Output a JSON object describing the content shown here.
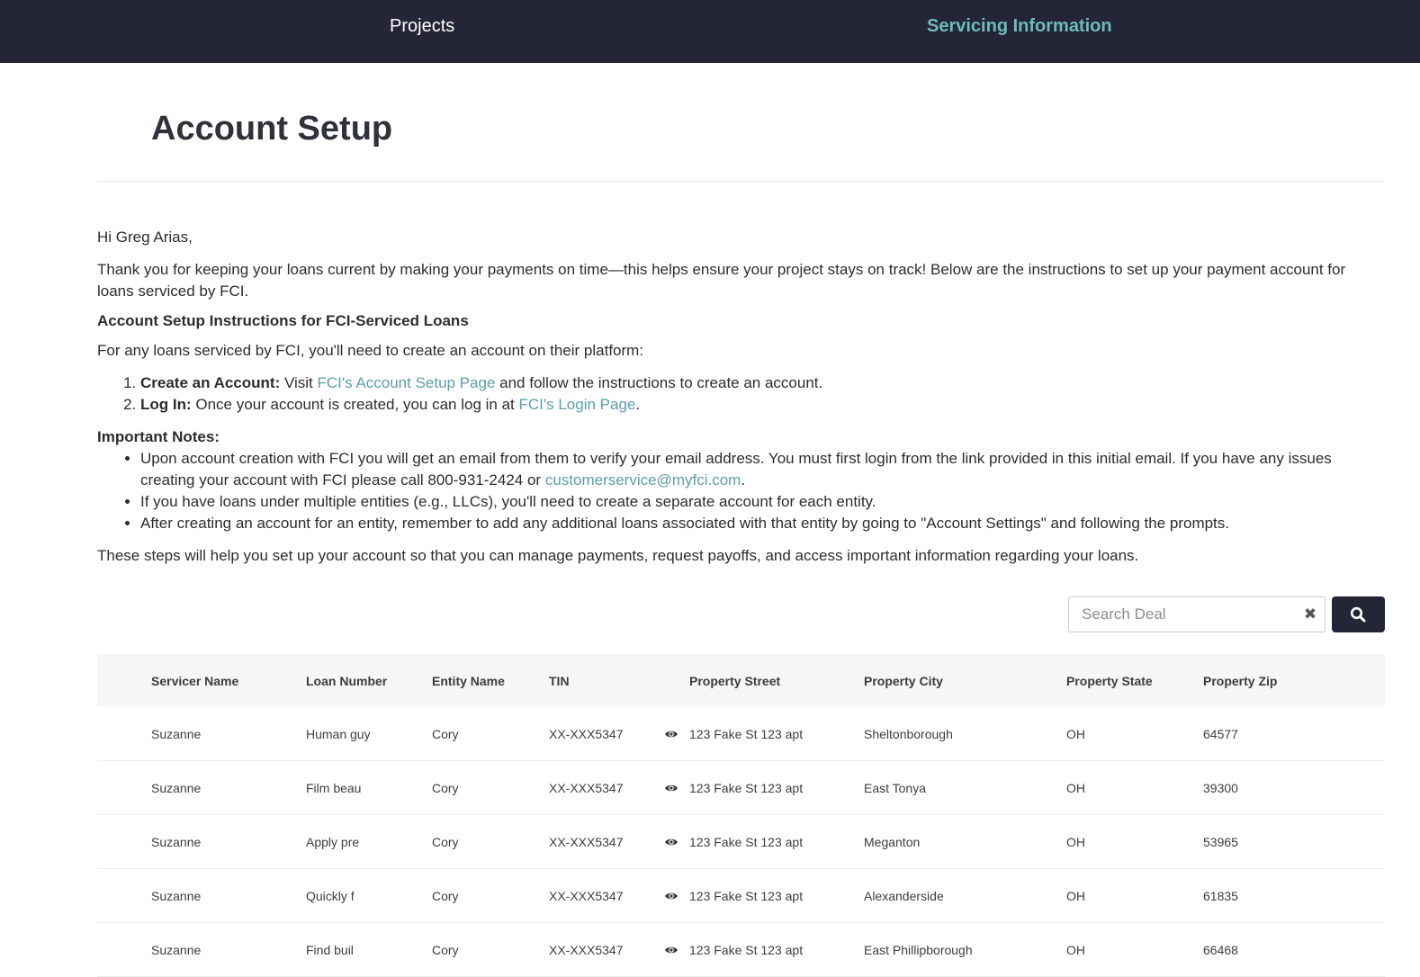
{
  "nav": {
    "projects": "Projects",
    "servicing": "Servicing Information"
  },
  "page": {
    "title": "Account Setup"
  },
  "letter": {
    "greeting": "Hi Greg Arias,",
    "intro": "Thank you for keeping your loans current by making your payments on time—this helps ensure your project stays on track! Below are the instructions to set up your payment account for loans serviced by FCI.",
    "subheading": "Account Setup Instructions for FCI-Serviced Loans",
    "lead": "For any loans serviced by FCI, you'll need to create an account on their platform:",
    "step1_label": "Create an Account:",
    "step1_pre": " Visit ",
    "step1_link": "FCI's Account Setup Page",
    "step1_post": " and follow the instructions to create an account.",
    "step2_label": "Log In:",
    "step2_pre": " Once your account is created, you can log in at ",
    "step2_link": "FCI's Login Page",
    "step2_post": ".",
    "notes_heading": "Important Notes:",
    "note1_pre": "Upon account creation with FCI you will get an email from them to verify your email address. You must first login from the link provided in this initial email. If you have any issues creating your account with FCI please call 800-931-2424 or ",
    "note1_link": "customerservice@myfci.com",
    "note1_post": ".",
    "note2": "If you have loans under multiple entities (e.g., LLCs), you'll need to create a separate account for each entity.",
    "note3": "After creating an account for an entity, remember to add any additional loans associated with that entity by going to \"Account Settings\" and following the prompts.",
    "closing": "These steps will help you set up your account so that you can manage payments, request payoffs, and access important information regarding your loans."
  },
  "search": {
    "placeholder": "Search Deal",
    "value": ""
  },
  "table": {
    "headers": {
      "servicer": "Servicer Name",
      "loan": "Loan Number",
      "entity": "Entity Name",
      "tin": "TIN",
      "street": "Property Street",
      "city": "Property City",
      "state": "Property State",
      "zip": "Property Zip"
    },
    "rows": [
      {
        "servicer": "Suzanne",
        "loan": "Human guy",
        "entity": "Cory",
        "tin": "XX-XXX5347",
        "street": "123 Fake St 123 apt",
        "city": "Sheltonborough",
        "state": "OH",
        "zip": "64577"
      },
      {
        "servicer": "Suzanne",
        "loan": "Film beau",
        "entity": "Cory",
        "tin": "XX-XXX5347",
        "street": "123 Fake St 123 apt",
        "city": "East Tonya",
        "state": "OH",
        "zip": "39300"
      },
      {
        "servicer": "Suzanne",
        "loan": "Apply pre",
        "entity": "Cory",
        "tin": "XX-XXX5347",
        "street": "123 Fake St 123 apt",
        "city": "Meganton",
        "state": "OH",
        "zip": "53965"
      },
      {
        "servicer": "Suzanne",
        "loan": "Quickly f",
        "entity": "Cory",
        "tin": "XX-XXX5347",
        "street": "123 Fake St 123 apt",
        "city": "Alexanderside",
        "state": "OH",
        "zip": "61835"
      },
      {
        "servicer": "Suzanne",
        "loan": "Find buil",
        "entity": "Cory",
        "tin": "XX-XXX5347",
        "street": "123 Fake St 123 apt",
        "city": "East Phillipborough",
        "state": "OH",
        "zip": "66468"
      }
    ]
  },
  "icons": {
    "clear": "close-icon",
    "search": "search-icon",
    "reveal_tin": "eye-icon"
  },
  "colors": {
    "nav_background": "#252538",
    "nav_active": "#6bbcba",
    "link": "#5b9fa8"
  }
}
